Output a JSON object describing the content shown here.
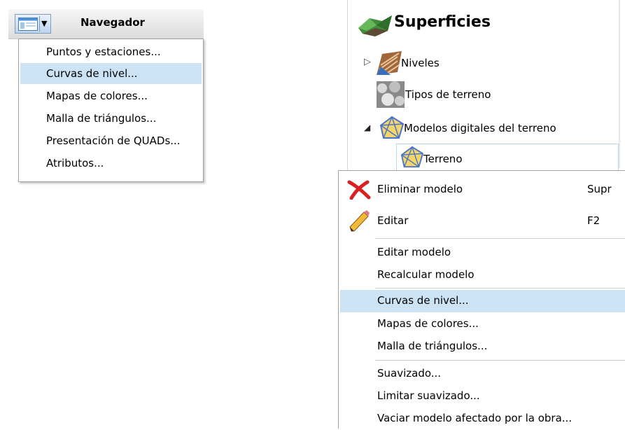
{
  "toolbar": {
    "title": "Navegador",
    "button_icons": [
      "window-icon",
      "dropdown-caret-icon"
    ]
  },
  "dropdown": {
    "items": [
      {
        "label": "Puntos y estaciones..."
      },
      {
        "label": "Curvas de nivel...",
        "highlighted": true
      },
      {
        "label": "Mapas de colores..."
      },
      {
        "label": "Malla de triángulos..."
      },
      {
        "label": "Presentación de QUADs..."
      },
      {
        "label": "Atributos..."
      }
    ]
  },
  "tree": {
    "root": "Superficies",
    "niveles": "Niveles",
    "tipos": "Tipos de terreno",
    "modelos": "Modelos digitales del terreno",
    "terreno": "Terreno"
  },
  "context_menu": {
    "items": [
      {
        "label": "Eliminar modelo",
        "shortcut": "Supr",
        "icon": "delete-x-icon"
      },
      {
        "label": "Editar",
        "shortcut": "F2",
        "icon": "pencil-icon"
      },
      {
        "label": "Editar modelo"
      },
      {
        "label": "Recalcular modelo"
      },
      {
        "label": "Curvas de nivel...",
        "highlighted": true
      },
      {
        "label": "Mapas de colores..."
      },
      {
        "label": "Malla de triángulos..."
      },
      {
        "label": "Suavizado..."
      },
      {
        "label": "Limitar suavizado..."
      },
      {
        "label": "Vaciar modelo afectado por la obra..."
      }
    ]
  },
  "colors": {
    "highlight": "#cce2f5",
    "menu_border": "#a0a0a0"
  }
}
